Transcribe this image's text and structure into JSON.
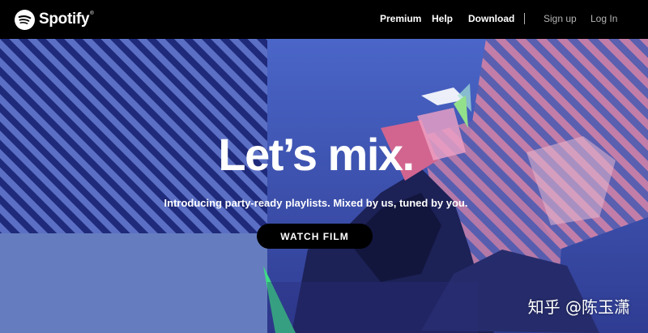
{
  "nav": {
    "brand": "Spotify",
    "links": [
      {
        "label": "Premium"
      },
      {
        "label": "Help"
      },
      {
        "label": "Download"
      },
      {
        "label": "Sign up"
      },
      {
        "label": "Log In"
      }
    ]
  },
  "hero": {
    "headline": "Let’s mix.",
    "subhead": "Introducing party-ready playlists. Mixed by us, tuned by you.",
    "cta_label": "WATCH FILM"
  },
  "watermark": "知乎 @陈玉潇",
  "colors": {
    "nav_bg": "#000000",
    "hero_blue": "#3a4ea9",
    "stripe_dark": "#1f2a7a",
    "stripe_pink": "#c27ea8",
    "accent_green": "#3ddc84",
    "button_bg": "#000000"
  },
  "icons": {
    "logo": "spotify-logo-icon"
  }
}
